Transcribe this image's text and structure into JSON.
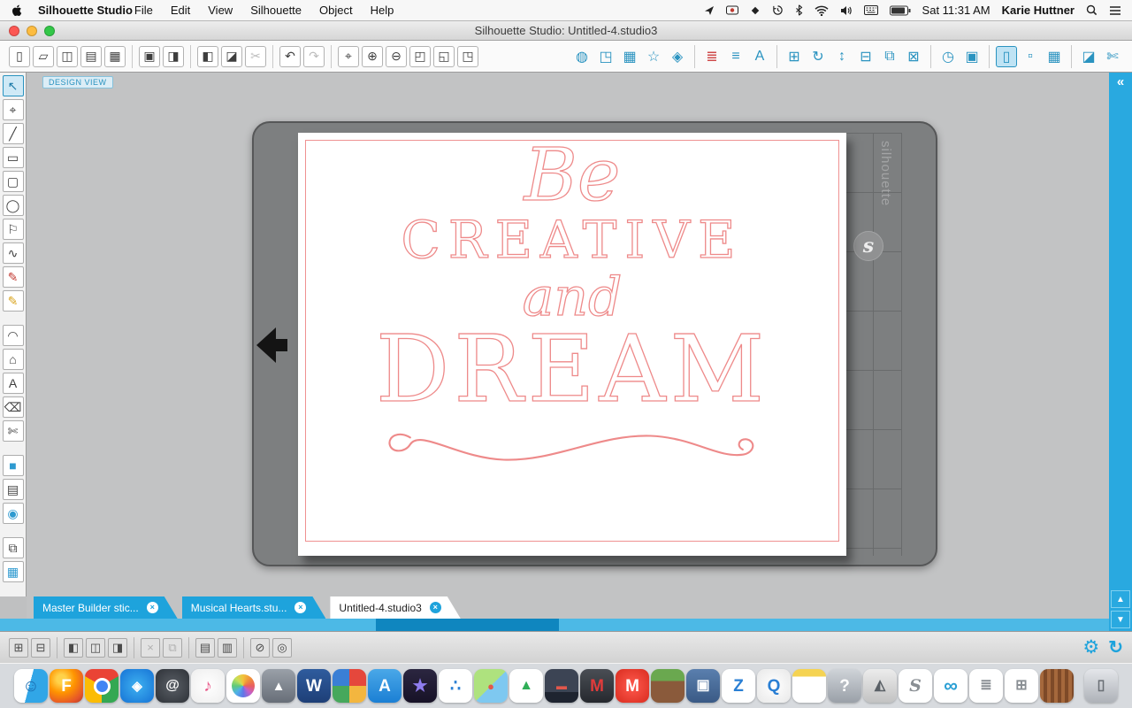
{
  "menu_bar": {
    "app_name": "Silhouette Studio",
    "menus": [
      {
        "name": "file",
        "label": "File"
      },
      {
        "name": "edit",
        "label": "Edit"
      },
      {
        "name": "view",
        "label": "View"
      },
      {
        "name": "silhouette",
        "label": "Silhouette"
      },
      {
        "name": "object",
        "label": "Object"
      },
      {
        "name": "help",
        "label": "Help"
      }
    ],
    "status": {
      "time": "Sat 11:31 AM",
      "user": "Karie Huttner"
    }
  },
  "window": {
    "title": "Silhouette Studio: Untitled-4.studio3"
  },
  "toolbar": {
    "left": [
      {
        "name": "new-document",
        "glyph": "▯"
      },
      {
        "name": "open",
        "glyph": "▱"
      },
      {
        "name": "open-from-library",
        "glyph": "◫"
      },
      {
        "name": "save",
        "glyph": "▤"
      },
      {
        "name": "save-to-library",
        "glyph": "▦"
      },
      {
        "name": "separator",
        "glyph": "",
        "cls": "sep"
      },
      {
        "name": "print",
        "glyph": "▣"
      },
      {
        "name": "print-preview",
        "glyph": "◨"
      },
      {
        "name": "separator",
        "glyph": "",
        "cls": "sep"
      },
      {
        "name": "copy",
        "glyph": "◧"
      },
      {
        "name": "paste",
        "glyph": "◪"
      },
      {
        "name": "cut",
        "glyph": "✂",
        "cls": "dim"
      },
      {
        "name": "separator",
        "glyph": "",
        "cls": "sep"
      },
      {
        "name": "undo",
        "glyph": "↶"
      },
      {
        "name": "redo",
        "glyph": "↷",
        "cls": "dim"
      },
      {
        "name": "separator",
        "glyph": "",
        "cls": "sep"
      },
      {
        "name": "pan",
        "glyph": "⌖"
      },
      {
        "name": "zoom-in",
        "glyph": "⊕"
      },
      {
        "name": "zoom-out",
        "glyph": "⊖"
      },
      {
        "name": "zoom-selection",
        "glyph": "◰"
      },
      {
        "name": "drag-zoom",
        "glyph": "◱"
      },
      {
        "name": "fit-to-page",
        "glyph": "◳"
      }
    ],
    "right": [
      {
        "name": "send-to-machine",
        "glyph": "◍"
      },
      {
        "name": "page-settings",
        "glyph": "◳"
      },
      {
        "name": "grid-settings",
        "glyph": "▦"
      },
      {
        "name": "offset",
        "glyph": "☆"
      },
      {
        "name": "trace",
        "glyph": "◈"
      },
      {
        "name": "separator",
        "glyph": "",
        "cls": "sep"
      },
      {
        "name": "line-style",
        "glyph": "≣",
        "cls": "red"
      },
      {
        "name": "fill-style",
        "glyph": "≡"
      },
      {
        "name": "text-style",
        "glyph": "A"
      },
      {
        "name": "separator",
        "glyph": "",
        "cls": "sep"
      },
      {
        "name": "transform",
        "glyph": "⊞"
      },
      {
        "name": "rotate",
        "glyph": "↻"
      },
      {
        "name": "scale",
        "glyph": "↕"
      },
      {
        "name": "align",
        "glyph": "⊟"
      },
      {
        "name": "replicate",
        "glyph": "⧉"
      },
      {
        "name": "modify",
        "glyph": "⊠"
      },
      {
        "name": "separator",
        "glyph": "",
        "cls": "sep"
      },
      {
        "name": "timer",
        "glyph": "◷"
      },
      {
        "name": "preview",
        "glyph": "▣"
      },
      {
        "name": "separator",
        "glyph": "",
        "cls": "sep"
      },
      {
        "name": "panel-design",
        "glyph": "▯",
        "active": true
      },
      {
        "name": "panel-store",
        "glyph": "▫"
      },
      {
        "name": "panel-library",
        "glyph": "▦"
      },
      {
        "name": "separator",
        "glyph": "",
        "cls": "sep"
      },
      {
        "name": "eraser-tool",
        "glyph": "◪"
      },
      {
        "name": "blade-tool",
        "glyph": "✄"
      }
    ]
  },
  "left_tools": [
    {
      "name": "select",
      "glyph": "↖",
      "active": true
    },
    {
      "name": "edit-points",
      "glyph": "⌖"
    },
    {
      "name": "line",
      "glyph": "╱"
    },
    {
      "name": "rectangle",
      "glyph": "▭"
    },
    {
      "name": "rounded-rectangle",
      "glyph": "▢"
    },
    {
      "name": "ellipse",
      "glyph": "◯"
    },
    {
      "name": "polygon",
      "glyph": "⚐"
    },
    {
      "name": "curve",
      "glyph": "∿"
    },
    {
      "name": "freehand",
      "glyph": "✎",
      "cls": "red"
    },
    {
      "name": "smooth-freehand",
      "glyph": "✎",
      "cls": "yellow"
    },
    {
      "name": "gap",
      "glyph": "",
      "cls": "gap"
    },
    {
      "name": "arc",
      "glyph": "◠"
    },
    {
      "name": "regular-polygon",
      "glyph": "⌂"
    },
    {
      "name": "text",
      "glyph": "A"
    },
    {
      "name": "eraser",
      "glyph": "⌫"
    },
    {
      "name": "knife",
      "glyph": "✄"
    },
    {
      "name": "gap",
      "glyph": "",
      "cls": "gap"
    },
    {
      "name": "fill",
      "glyph": "■",
      "cls": "blue"
    },
    {
      "name": "sketch",
      "glyph": "▤"
    },
    {
      "name": "store",
      "glyph": "◉",
      "cls": "blue"
    },
    {
      "name": "gap",
      "glyph": "",
      "cls": "gap"
    },
    {
      "name": "page-panel",
      "glyph": "⧉"
    },
    {
      "name": "grid-panel",
      "glyph": "▦",
      "cls": "teal"
    }
  ],
  "canvas": {
    "badge": "DESIGN VIEW",
    "page": {
      "word1": "Be",
      "word2": "CREATIVE",
      "word3": "and",
      "word4": "DREAM"
    },
    "mat": {
      "brand": "silhouette",
      "logo": "s"
    }
  },
  "tabs": [
    {
      "name": "master-builder",
      "label": "Master Builder stic...",
      "close": "×"
    },
    {
      "name": "musical-hearts",
      "label": "Musical Hearts.stu...",
      "close": "×"
    },
    {
      "name": "untitled-4",
      "label": "Untitled-4.studio3",
      "close": "×",
      "active": true
    }
  ],
  "right_panel": {
    "collapse": "«",
    "up": "▲",
    "down": "▼"
  },
  "bottom_toolbar": {
    "items": [
      {
        "name": "transform-a",
        "glyph": "⊞"
      },
      {
        "name": "transform-b",
        "glyph": "⊟"
      },
      {
        "name": "separator",
        "glyph": "",
        "cls": "sep"
      },
      {
        "name": "align-left",
        "glyph": "◧"
      },
      {
        "name": "align-center",
        "glyph": "◫"
      },
      {
        "name": "align-right",
        "glyph": "◨"
      },
      {
        "name": "separator",
        "glyph": "",
        "cls": "sep"
      },
      {
        "name": "weld",
        "glyph": "×",
        "cls": "dim"
      },
      {
        "name": "subtract",
        "glyph": "⧉",
        "cls": "dim"
      },
      {
        "name": "separator",
        "glyph": "",
        "cls": "sep"
      },
      {
        "name": "group",
        "glyph": "▤"
      },
      {
        "name": "ungroup",
        "glyph": "▥"
      },
      {
        "name": "separator",
        "glyph": "",
        "cls": "sep"
      },
      {
        "name": "lock",
        "glyph": "⊘"
      },
      {
        "name": "registration",
        "glyph": "◎"
      }
    ],
    "gear": "⚙",
    "refresh": "↻"
  },
  "dock": [
    {
      "name": "finder",
      "glyph": "☺",
      "cls": "dk-finder"
    },
    {
      "name": "firefox",
      "glyph": "F",
      "cls": "dk-firefox"
    },
    {
      "name": "chrome",
      "glyph": "",
      "cls": "dk-chrome"
    },
    {
      "name": "safari",
      "glyph": "◈",
      "cls": "dk-safari"
    },
    {
      "name": "mail",
      "glyph": "@",
      "cls": "dk-mail"
    },
    {
      "name": "itunes",
      "glyph": "♪",
      "cls": "dk-itunes"
    },
    {
      "name": "photos",
      "glyph": "",
      "cls": "dk-photos"
    },
    {
      "name": "launchpad",
      "glyph": "▲",
      "cls": "dk-launchpad"
    },
    {
      "name": "word",
      "glyph": "W",
      "cls": "dk-word"
    },
    {
      "name": "tiles-game",
      "glyph": "",
      "cls": "dk-tiles"
    },
    {
      "name": "app-store",
      "glyph": "A",
      "cls": "dk-appstore"
    },
    {
      "name": "star-app",
      "glyph": "★",
      "cls": "dk-star"
    },
    {
      "name": "dots-app",
      "glyph": "∴",
      "cls": "dk-dots"
    },
    {
      "name": "maps",
      "glyph": "●",
      "cls": "dk-maps"
    },
    {
      "name": "google-drive",
      "glyph": "▲",
      "cls": "dk-drive"
    },
    {
      "name": "display-app",
      "glyph": "▬",
      "cls": "dk-display"
    },
    {
      "name": "m-badge-app",
      "glyph": "M",
      "cls": "dk-mbadge"
    },
    {
      "name": "miniclip",
      "glyph": "M",
      "cls": "dk-miniclip"
    },
    {
      "name": "minecraft",
      "glyph": "",
      "cls": "dk-minecraft"
    },
    {
      "name": "cube-app",
      "glyph": "▣",
      "cls": "dk-cube"
    },
    {
      "name": "z-app",
      "glyph": "Z",
      "cls": "dk-zapp"
    },
    {
      "name": "quicktime",
      "glyph": "Q",
      "cls": "dk-quicktime"
    },
    {
      "name": "notes",
      "glyph": "",
      "cls": "dk-notes"
    },
    {
      "name": "missing-app",
      "glyph": "?",
      "cls": "dk-question"
    },
    {
      "name": "cad-app",
      "glyph": "◭",
      "cls": "dk-cad"
    },
    {
      "name": "silhouette-studio",
      "glyph": "S",
      "cls": "dk-silhouette"
    },
    {
      "name": "infinity-app",
      "glyph": "∞",
      "cls": "dk-infinity"
    },
    {
      "name": "documents-app",
      "glyph": "≣",
      "cls": "dk-docs"
    },
    {
      "name": "widget-app",
      "glyph": "⊞",
      "cls": "dk-widget"
    },
    {
      "name": "radio-app",
      "glyph": "",
      "cls": "dk-radio"
    },
    {
      "name": "trash",
      "glyph": "▯",
      "cls": "dk-trash"
    }
  ],
  "colors": {
    "accent": "#29a9e0",
    "cut_line": "#ee8a8a",
    "tab_blue": "#1ea3dc"
  }
}
